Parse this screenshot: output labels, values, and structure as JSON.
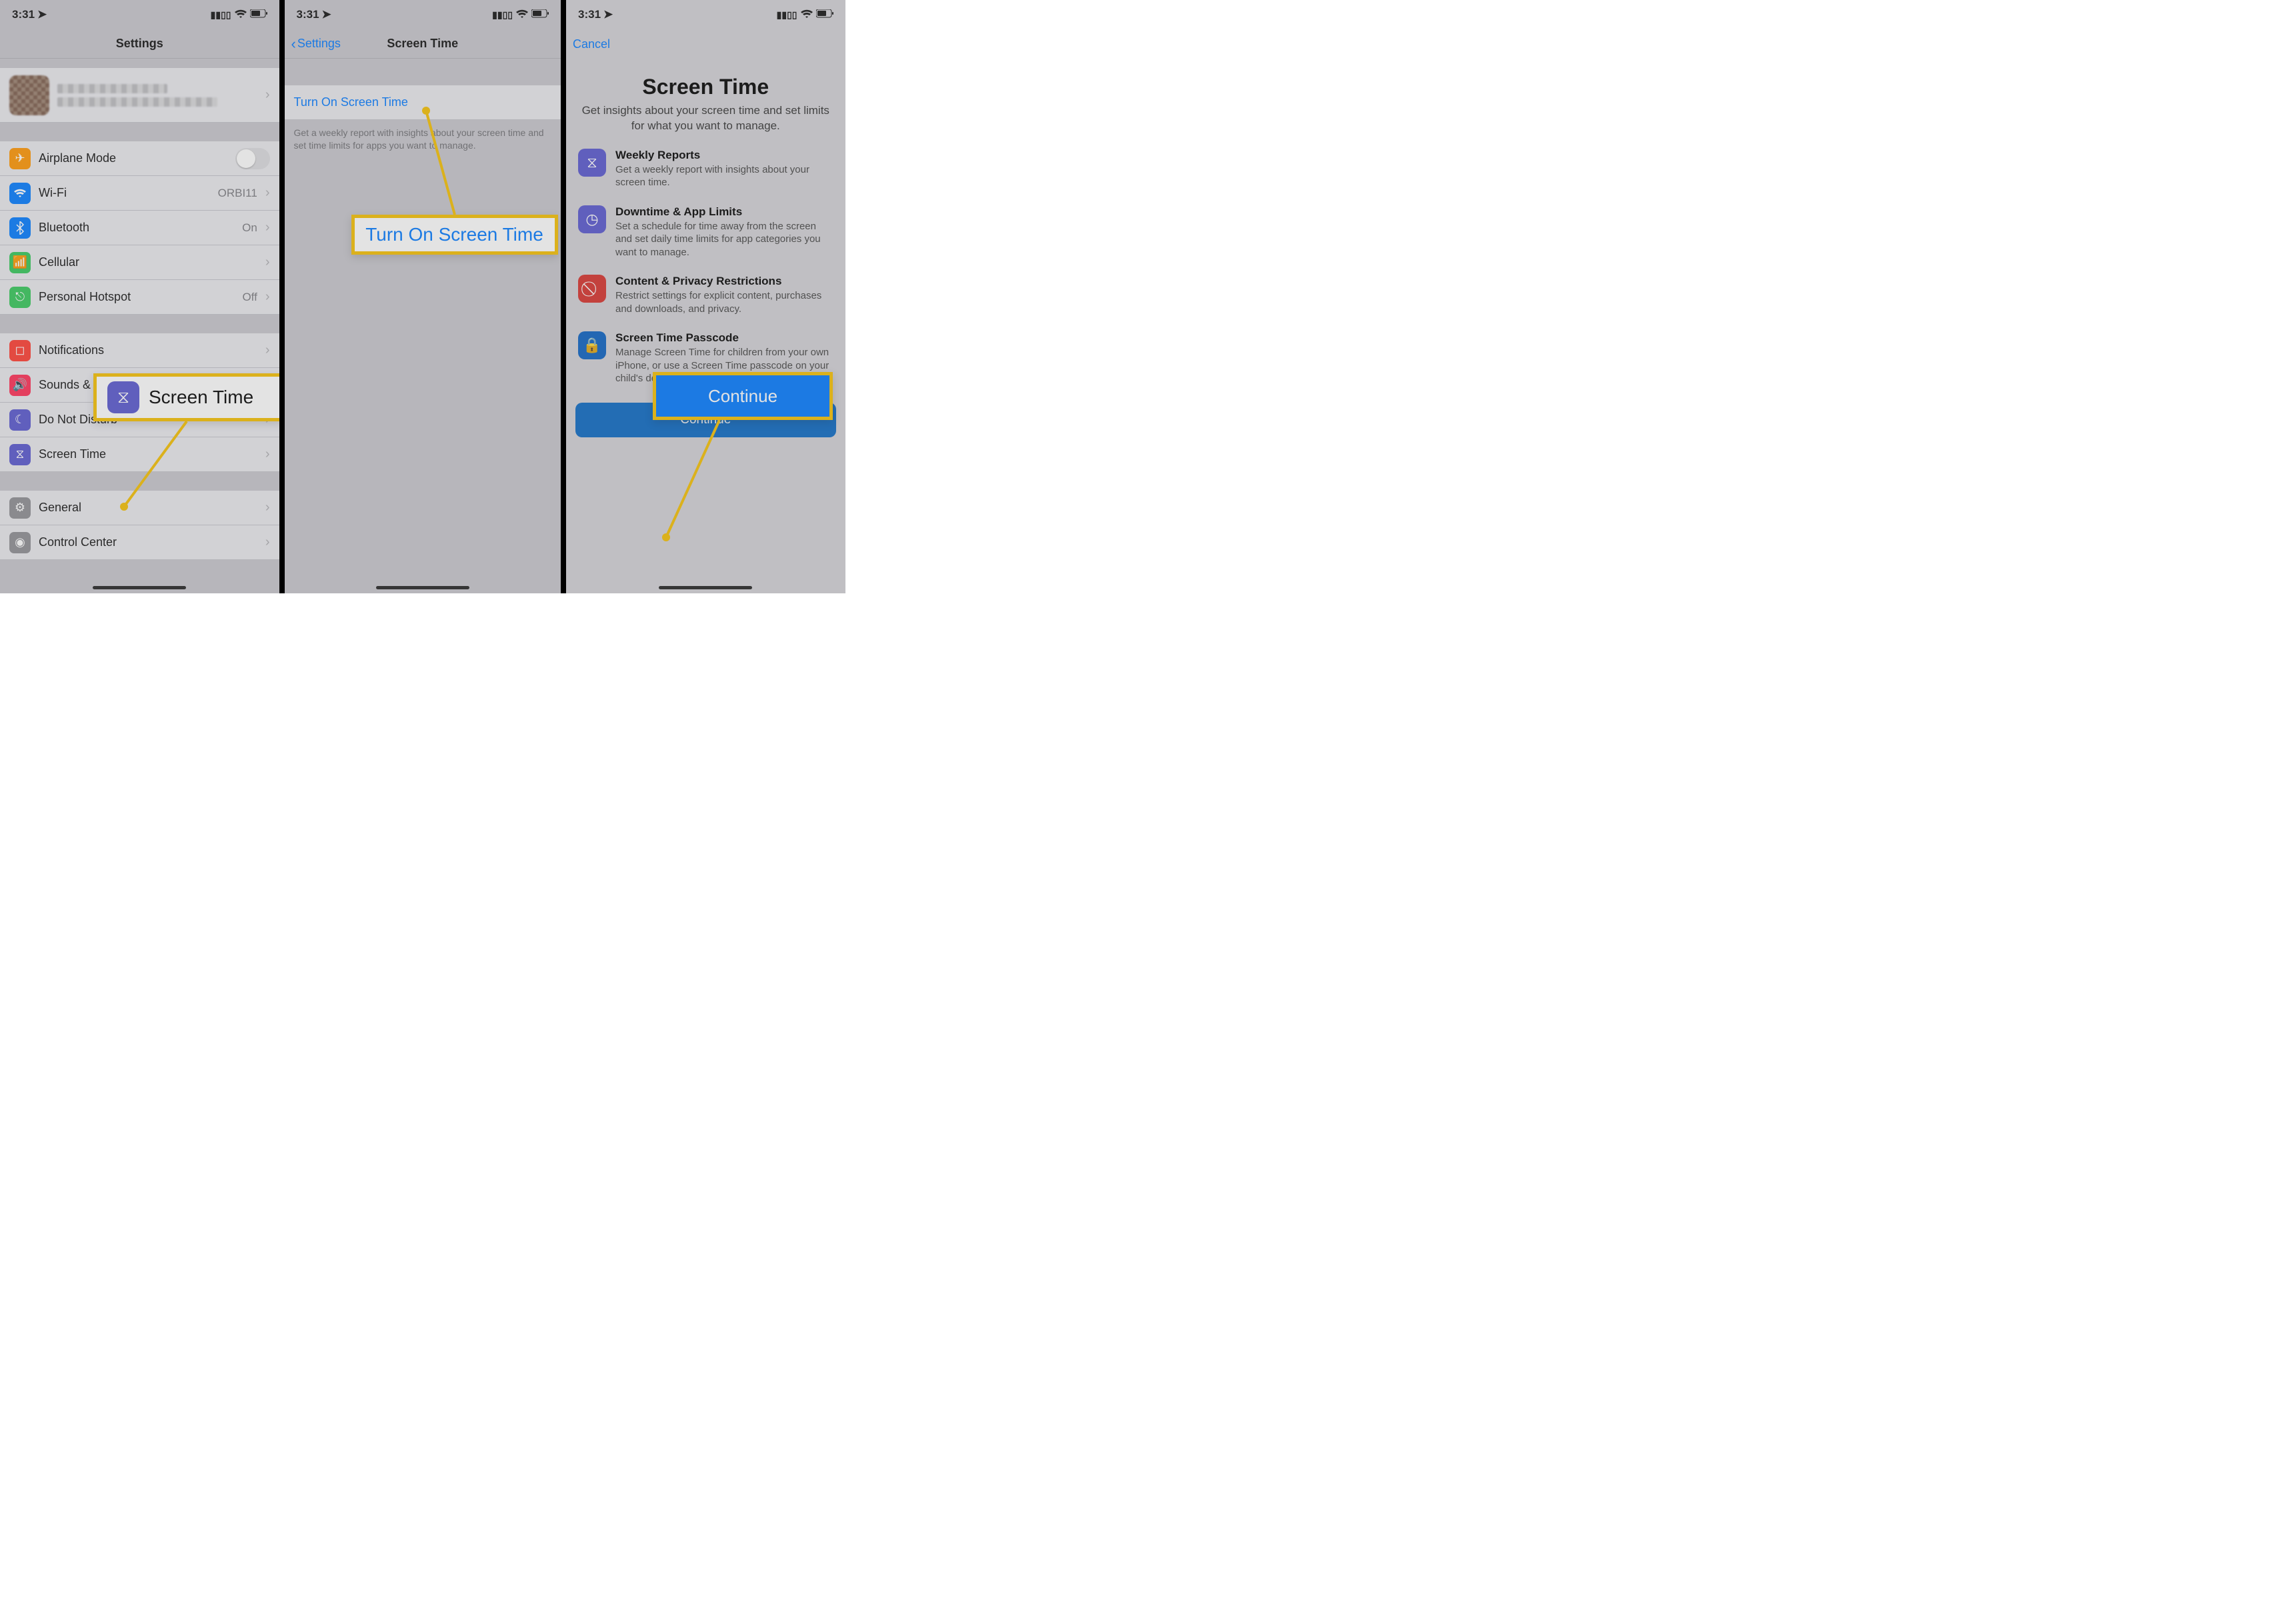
{
  "status_time": "3:31",
  "phone1": {
    "title": "Settings",
    "rows": {
      "airplane": "Airplane Mode",
      "wifi": "Wi-Fi",
      "wifi_val": "ORBI11",
      "bt": "Bluetooth",
      "bt_val": "On",
      "cell": "Cellular",
      "hotspot": "Personal Hotspot",
      "hotspot_val": "Off",
      "notif": "Notifications",
      "sounds": "Sounds & Haptics",
      "dnd": "Do Not Disturb",
      "st": "Screen Time",
      "general": "General",
      "cc": "Control Center"
    },
    "callout": "Screen Time"
  },
  "phone2": {
    "back": "Settings",
    "title": "Screen Time",
    "row": "Turn On Screen Time",
    "footer": "Get a weekly report with insights about your screen time and set time limits for apps you want to manage.",
    "callout": "Turn On Screen Time"
  },
  "phone3": {
    "cancel": "Cancel",
    "headline": "Screen Time",
    "sub": "Get insights about your screen time and set limits for what you want to manage.",
    "f1t": "Weekly Reports",
    "f1d": "Get a weekly report with insights about your screen time.",
    "f2t": "Downtime & App Limits",
    "f2d": "Set a schedule for time away from the screen and set daily time limits for app categories you want to manage.",
    "f3t": "Content & Privacy Restrictions",
    "f3d": "Restrict settings for explicit content, purchases and downloads, and privacy.",
    "f4t": "Screen Time Passcode",
    "f4d": "Manage Screen Time for children from your own iPhone, or use a Screen Time passcode on your child's device.",
    "continue": "Continue",
    "callout": "Continue"
  }
}
